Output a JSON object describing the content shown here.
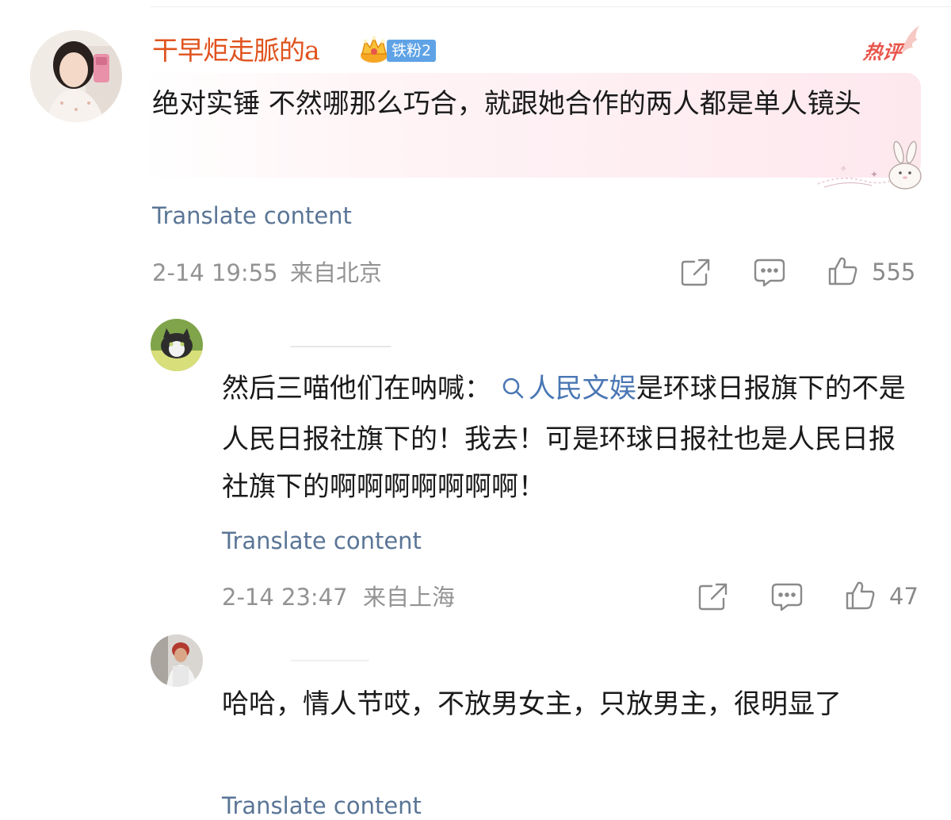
{
  "comment": {
    "username": "干早炬走脈的a",
    "fan_badge": "铁粉2",
    "hot_badge": "热评",
    "text": "绝对实锤 不然哪那么巧合，就跟她合作的两人都是单人镜头",
    "translate": "Translate content",
    "timestamp": "2-14 19:55",
    "location": "来自北京",
    "likes": "555"
  },
  "replies": [
    {
      "text_before": "然后三喵他们在呐喊：",
      "link": "人民文娱",
      "text_after": "是环球日报旗下的不是人民日报社旗下的！我去！可是环球日报社也是人民日报社旗下的啊啊啊啊啊啊啊！",
      "translate": "Translate content",
      "timestamp": "2-14 23:47",
      "location": "来自上海",
      "likes": "47"
    },
    {
      "text": "哈哈，情人节哎，不放男女主，只放男主，很明显了",
      "translate": "Translate content"
    }
  ],
  "icons": {
    "share": "share-icon",
    "comment": "comment-icon",
    "like": "thumbs-up-icon",
    "search": "search-icon"
  },
  "colors": {
    "username": "#e0531e",
    "fan_badge": "#5fa3e6",
    "hot_badge": "#e8554b",
    "link": "#4a77b4",
    "translate": "#5a7596",
    "meta": "#939393"
  }
}
